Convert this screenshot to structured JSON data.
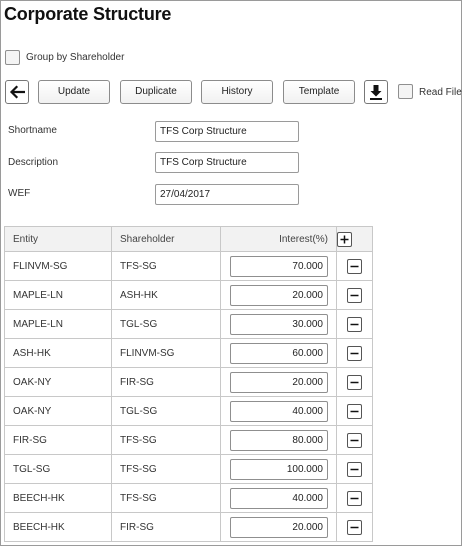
{
  "page": {
    "title": "Corporate Structure"
  },
  "options": {
    "group_by_label": "Group by Shareholder",
    "read_file_label": "Read File"
  },
  "toolbar": {
    "update": "Update",
    "duplicate": "Duplicate",
    "history": "History",
    "template": "Template",
    "back_icon": "arrow-left-icon",
    "download_icon": "download-icon"
  },
  "form": {
    "shortname": {
      "label": "Shortname",
      "value": "TFS Corp Structure"
    },
    "description": {
      "label": "Description",
      "value": "TFS Corp Structure"
    },
    "wef": {
      "label": "WEF",
      "value": "27/04/2017"
    }
  },
  "table": {
    "headers": {
      "entity": "Entity",
      "shareholder": "Shareholder",
      "interest": "Interest(%)"
    },
    "rows": [
      {
        "entity": "FLINVM-SG",
        "shareholder": "TFS-SG",
        "interest": "70.000"
      },
      {
        "entity": "MAPLE-LN",
        "shareholder": "ASH-HK",
        "interest": "20.000"
      },
      {
        "entity": "MAPLE-LN",
        "shareholder": "TGL-SG",
        "interest": "30.000"
      },
      {
        "entity": "ASH-HK",
        "shareholder": "FLINVM-SG",
        "interest": "60.000"
      },
      {
        "entity": "OAK-NY",
        "shareholder": "FIR-SG",
        "interest": "20.000"
      },
      {
        "entity": "OAK-NY",
        "shareholder": "TGL-SG",
        "interest": "40.000"
      },
      {
        "entity": "FIR-SG",
        "shareholder": "TFS-SG",
        "interest": "80.000"
      },
      {
        "entity": "TGL-SG",
        "shareholder": "TFS-SG",
        "interest": "100.000"
      },
      {
        "entity": "BEECH-HK",
        "shareholder": "TFS-SG",
        "interest": "40.000"
      },
      {
        "entity": "BEECH-HK",
        "shareholder": "FIR-SG",
        "interest": "20.000"
      }
    ]
  },
  "colors": {
    "border": "#8c8c8c",
    "header_bg": "#f2f2f2",
    "grid_line": "#c8c8c8"
  }
}
